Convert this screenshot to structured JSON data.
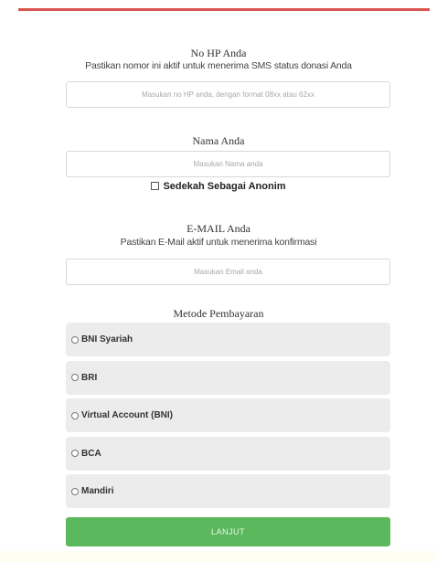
{
  "phone": {
    "label": "No HP Anda",
    "hint": "Pastikan nomor ini aktif untuk menerima SMS status donasi Anda",
    "placeholder": "Masukan no HP anda, dengan format 08xx atau 62xx"
  },
  "name": {
    "label": "Nama Anda",
    "placeholder": "Masukan Nama anda",
    "anonymous_label": "Sedekah Sebagai Anonim"
  },
  "email": {
    "label": "E-MAIL Anda",
    "hint": "Pastikan E-Mail aktif untuk menerima konfirmasi",
    "placeholder": "Masukan Email anda"
  },
  "payment": {
    "label": "Metode Pembayaran",
    "options": [
      "BNI Syariah",
      "BRI",
      "Virtual Account (BNI)",
      "BCA",
      "Mandiri"
    ]
  },
  "submit_label": "LANJUT",
  "colors": {
    "accent_bar": "#d9534f",
    "submit": "#5cb85c",
    "option_bg": "#ececec"
  }
}
